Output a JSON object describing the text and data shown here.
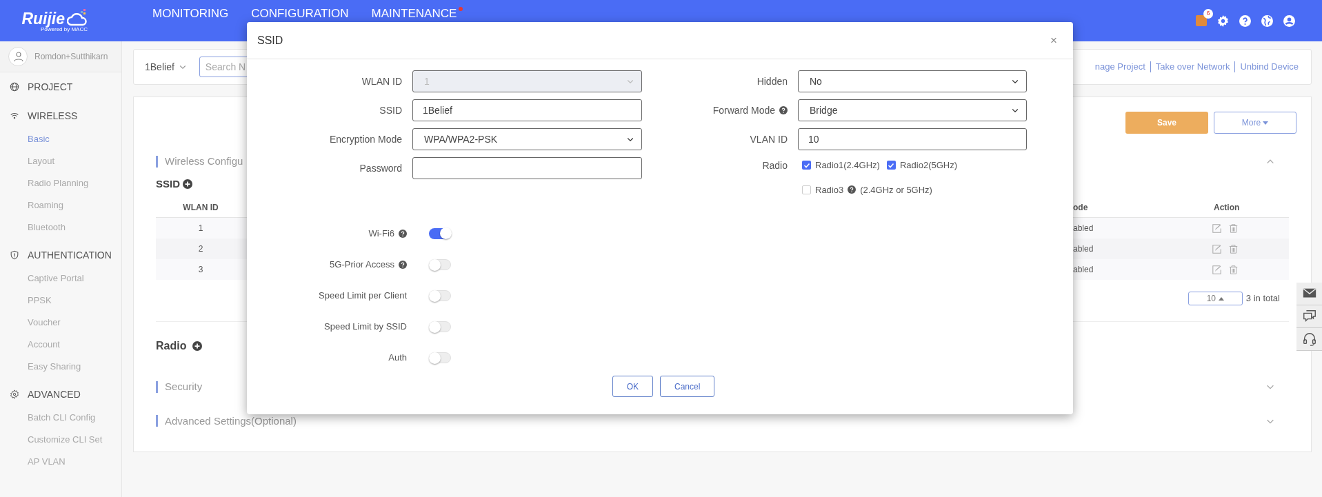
{
  "header": {
    "logo": "Ruijie",
    "logo_tagline": "Powered by MACC",
    "nav": [
      {
        "label": "MONITORING",
        "alert": false
      },
      {
        "label": "CONFIGURATION",
        "alert": false
      },
      {
        "label": "MAINTENANCE",
        "alert": true
      }
    ],
    "notification_count": "6"
  },
  "sidebar": {
    "user": "Romdon+Sutthikarn",
    "sections": [
      {
        "label": "PROJECT"
      },
      {
        "label": "WIRELESS",
        "items": [
          {
            "label": "Basic",
            "selected": true
          },
          {
            "label": "Layout",
            "selected": false
          },
          {
            "label": "Radio Planning",
            "selected": false
          },
          {
            "label": "Roaming",
            "selected": false
          },
          {
            "label": "Bluetooth",
            "selected": false
          }
        ]
      },
      {
        "label": "AUTHENTICATION",
        "items": [
          {
            "label": "Captive Portal",
            "selected": false
          },
          {
            "label": "PPSK",
            "selected": false
          },
          {
            "label": "Voucher",
            "selected": false
          },
          {
            "label": "Account",
            "selected": false
          },
          {
            "label": "Easy Sharing",
            "selected": false
          }
        ]
      },
      {
        "label": "ADVANCED",
        "items": [
          {
            "label": "Batch CLI Config",
            "selected": false
          },
          {
            "label": "Customize CLI Set",
            "selected": false
          },
          {
            "label": "AP VLAN",
            "selected": false
          }
        ]
      }
    ]
  },
  "toolbar": {
    "project": "1Belief",
    "search_placeholder": "Search N",
    "links": [
      "nage Project",
      "Take over Network",
      "Unbind Device"
    ]
  },
  "main": {
    "save": "Save",
    "more": "More",
    "sections": [
      {
        "title": "Wireless Configu",
        "expanded": true
      },
      {
        "title": "Security",
        "expanded": false
      },
      {
        "title": "Advanced Settings(Optional)",
        "expanded": false
      }
    ],
    "ssid_heading": "SSID",
    "radio_heading": "Radio",
    "table": {
      "columns": [
        "WLAN ID",
        "ode",
        "Action"
      ],
      "rows": [
        {
          "wlan_id": "1",
          "column_2": "abled"
        },
        {
          "wlan_id": "2",
          "column_2": "abled"
        },
        {
          "wlan_id": "3",
          "column_2": "abled"
        }
      ]
    },
    "page_size": "10",
    "total": "3 in total"
  },
  "modal": {
    "title": "SSID",
    "close": "×",
    "left_fields": [
      {
        "label": "WLAN ID",
        "kind": "select",
        "value": "1",
        "disabled": true,
        "help": false
      },
      {
        "label": "SSID",
        "kind": "text",
        "value": "1Belief",
        "disabled": false,
        "help": false
      },
      {
        "label": "Encryption Mode",
        "kind": "select",
        "value": "WPA/WPA2-PSK",
        "disabled": false,
        "help": false
      },
      {
        "label": "Password",
        "kind": "password",
        "disabled": false,
        "help": false
      }
    ],
    "right_fields": [
      {
        "label": "Hidden",
        "kind": "select",
        "value": "No",
        "disabled": false,
        "help": false
      },
      {
        "label": "Forward Mode",
        "kind": "select",
        "value": "Bridge",
        "disabled": false,
        "help": true
      },
      {
        "label": "VLAN ID",
        "kind": "text",
        "value": "10",
        "disabled": false,
        "help": false
      }
    ],
    "radio": {
      "label": "Radio",
      "options": [
        {
          "label": "Radio1(2.4GHz)",
          "checked": true,
          "help": false
        },
        {
          "label": "Radio2(5GHz)",
          "checked": true,
          "help": false
        },
        {
          "label": "Radio3",
          "note": "(2.4GHz or 5GHz)",
          "checked": false,
          "help": true
        }
      ]
    },
    "toggles": [
      {
        "label": "Wi-Fi6",
        "help": true,
        "on": true
      },
      {
        "label": "5G-Prior Access",
        "help": true,
        "on": false
      },
      {
        "label": "Speed Limit per Client",
        "help": false,
        "on": false
      },
      {
        "label": "Speed Limit by SSID",
        "help": false,
        "on": false
      },
      {
        "label": "Auth",
        "help": false,
        "on": false
      }
    ],
    "buttons": [
      "OK",
      "Cancel"
    ]
  }
}
